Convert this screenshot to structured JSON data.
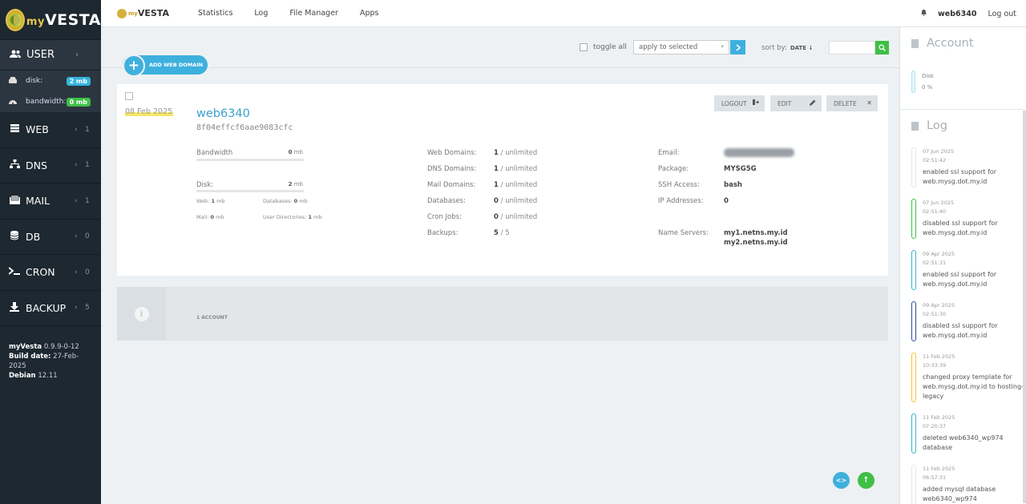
{
  "sidebar": {
    "logo": {
      "prefix": "my",
      "name": "VESTA"
    },
    "user": {
      "label": "USER",
      "icon": "users-icon"
    },
    "stats": [
      {
        "label": "disk:",
        "value": "2 mb",
        "color": "#35b5e0",
        "icon": "hdd-icon"
      },
      {
        "label": "bandwidth:",
        "value": "0 mb",
        "color": "#3fbf46",
        "icon": "dashboard-icon"
      }
    ],
    "items": [
      {
        "label": "WEB",
        "count": "1",
        "icon": "server-icon"
      },
      {
        "label": "DNS",
        "count": "1",
        "icon": "sitemap-icon"
      },
      {
        "label": "MAIL",
        "count": "1",
        "icon": "inbox-icon"
      },
      {
        "label": "DB",
        "count": "0",
        "icon": "database-icon"
      },
      {
        "label": "CRON",
        "count": "0",
        "icon": "terminal-icon"
      },
      {
        "label": "BACKUP",
        "count": "5",
        "icon": "download-icon"
      }
    ],
    "version": {
      "name_label": "myVesta",
      "name_value": "0.9.9-0-12",
      "build_label": "Build date:",
      "build_value": "27-Feb-2025",
      "os_label": "Debian",
      "os_value": "12.11"
    }
  },
  "topbar": {
    "logo_prefix": "my",
    "logo_name": "VESTA",
    "nav": [
      "Statistics",
      "Log",
      "File Manager",
      "Apps"
    ],
    "username": "web6340",
    "logout": "Log out"
  },
  "toolbar": {
    "add_label": "ADD WEB DOMAIN",
    "add_symbol": "+",
    "toggle_all": "toggle all",
    "apply_placeholder": "apply to selected",
    "sort_label": "sort by:",
    "sort_value": "DATE ↓"
  },
  "card": {
    "date": "08 Feb 2025",
    "title": "web6340",
    "hash": "8f04effcf6aae9083cfc",
    "buttons": {
      "logout": "LOGOUT",
      "edit": "EDIT",
      "delete": "DELETE"
    },
    "bandwidth": {
      "label": "Bandwidth",
      "value": "0",
      "unit": "mb"
    },
    "disk": {
      "label": "Disk:",
      "value": "2",
      "unit": "mb"
    },
    "disk_detail": {
      "web_label": "Web:",
      "web_value": "1",
      "web_unit": "mb",
      "db_label": "Databases:",
      "db_value": "0",
      "db_unit": "mb",
      "mail_label": "Mail:",
      "mail_value": "0",
      "mail_unit": "mb",
      "udir_label": "User Directories:",
      "udir_value": "1",
      "udir_unit": "mb"
    },
    "limits": [
      {
        "key": "Web Domains:",
        "value": "1",
        "limit": "/ unlimited"
      },
      {
        "key": "DNS Domains:",
        "value": "1",
        "limit": "/ unlimited"
      },
      {
        "key": "Mail Domains:",
        "value": "1",
        "limit": "/ unlimited"
      },
      {
        "key": "Databases:",
        "value": "0",
        "limit": "/ unlimited"
      },
      {
        "key": "Cron Jobs:",
        "value": "0",
        "limit": "/ unlimited"
      },
      {
        "key": "Backups:",
        "value": "5",
        "limit": "/ 5"
      }
    ],
    "info": {
      "email_label": "Email:",
      "package_label": "Package:",
      "package_value": "MYSG5G",
      "ssh_label": "SSH Access:",
      "ssh_value": "bash",
      "ip_label": "IP Addresses:",
      "ip_value": "0",
      "ns_label": "Name Servers:",
      "ns_1": "my1.netns.my.id",
      "ns_2": "my2.netns.my.id"
    }
  },
  "footer": {
    "accounts": "1 ACCOUNT",
    "info_symbol": "i"
  },
  "floating": {
    "code_symbol": "<>",
    "up_symbol": "↑"
  },
  "right_panel": {
    "account_title": "Account",
    "disk_label": "Disk",
    "disk_value": "0 %",
    "log_title": "Log",
    "log": [
      {
        "date": "07 Jun 2025",
        "time": "02:51:42",
        "msg": "enabled ssl support for web.mysg.dot.my.id",
        "color": "#e3e6e9"
      },
      {
        "date": "07 Jun 2025",
        "time": "02:51:40",
        "msg": "disabled ssl support for web.mysg.dot.my.id",
        "color": "#3fbf46"
      },
      {
        "date": "09 Apr 2025",
        "time": "02:51:31",
        "msg": "enabled ssl support for web.mysg.dot.my.id",
        "color": "#35b5c9"
      },
      {
        "date": "09 Apr 2025",
        "time": "02:51:30",
        "msg": "disabled ssl support for web.mysg.dot.my.id",
        "color": "#2f4a99"
      },
      {
        "date": "11 Feb 2025",
        "time": "10:33:39",
        "msg": "changed proxy template for web.mysg.dot.my.id to hosting-legacy",
        "color": "#f2c23a"
      },
      {
        "date": "11 Feb 2025",
        "time": "07:20:37",
        "msg": "deleted web6340_wp974 database",
        "color": "#35b5c9"
      },
      {
        "date": "11 Feb 2025",
        "time": "06:57:31",
        "msg": "added mysql database web6340_wp974",
        "color": "#e3e6e9"
      }
    ]
  }
}
